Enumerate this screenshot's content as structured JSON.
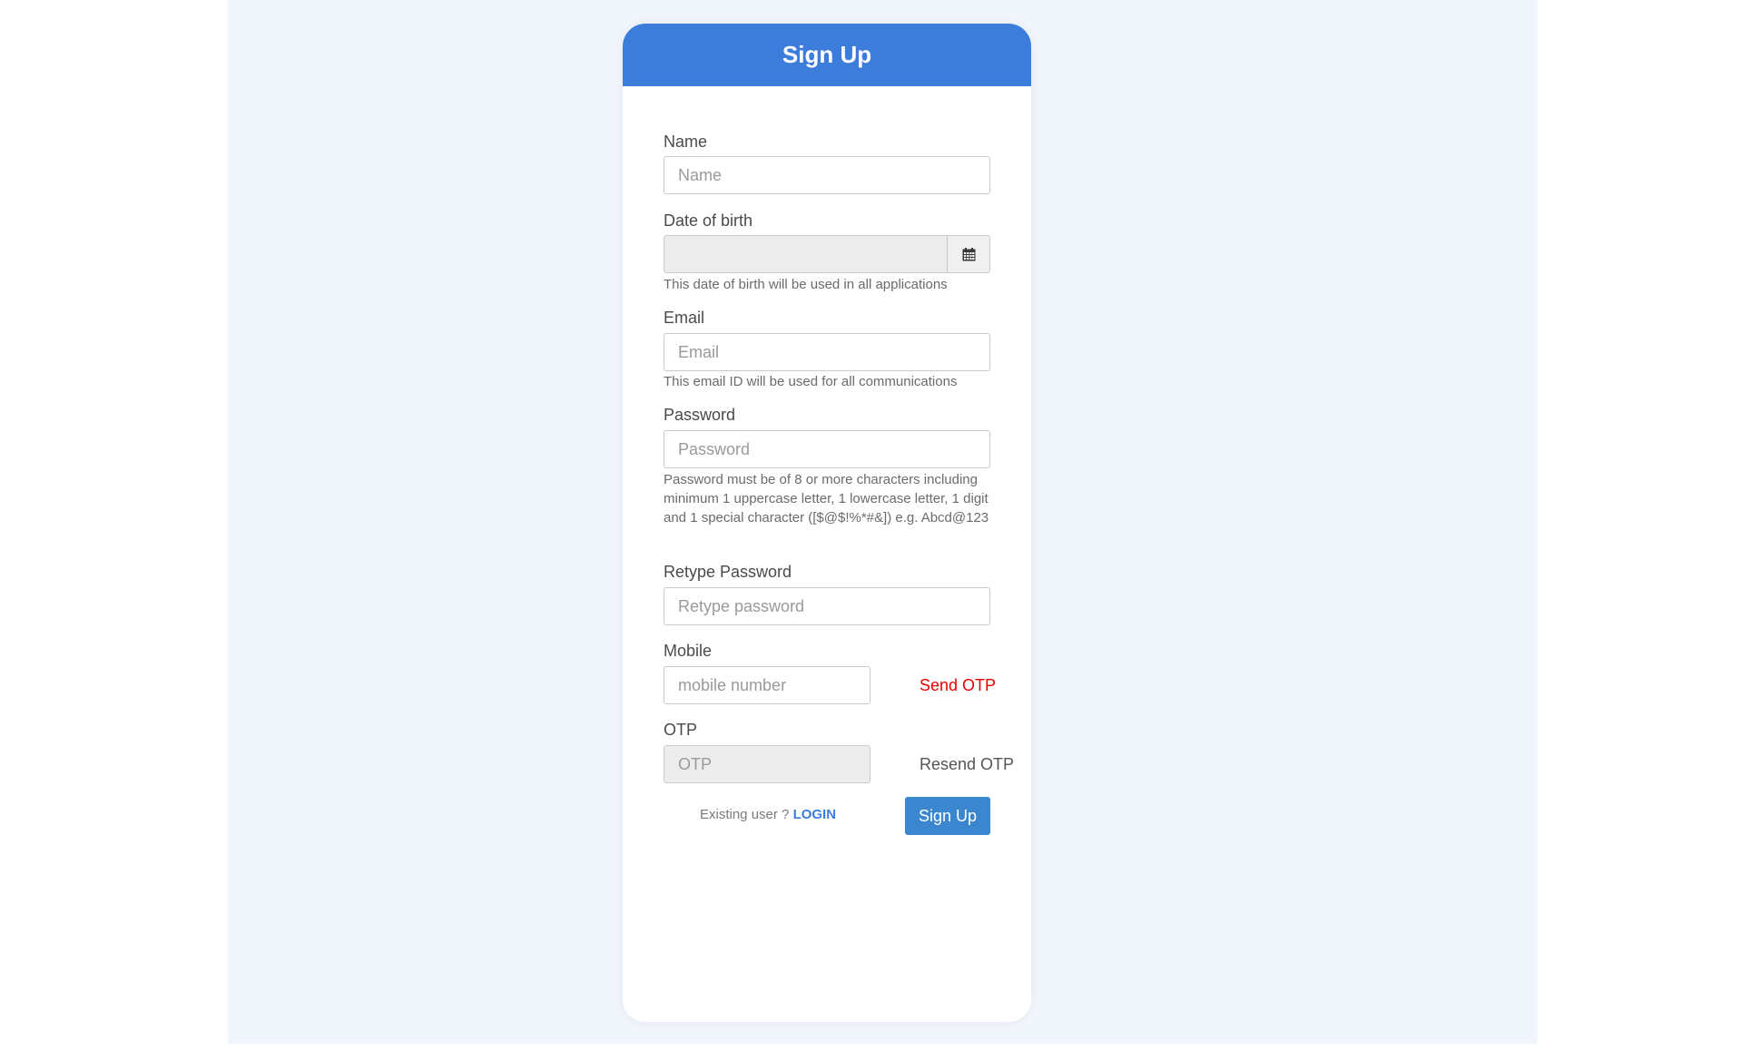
{
  "header": {
    "title": "Sign Up"
  },
  "form": {
    "name": {
      "label": "Name",
      "placeholder": "Name",
      "value": ""
    },
    "dob": {
      "label": "Date of birth",
      "value": "",
      "help": "This date of birth will be used in all applications",
      "icon": "calendar-icon"
    },
    "email": {
      "label": "Email",
      "placeholder": "Email",
      "value": "",
      "help": "This email ID will be used for all communications"
    },
    "password": {
      "label": "Password",
      "placeholder": "Password",
      "value": "",
      "help": "Password must be of 8 or more characters including minimum 1 uppercase letter, 1 lowercase letter, 1 digit and 1 special character ([$@$!%*#&]) e.g. Abcd@123"
    },
    "retype_password": {
      "label": "Retype Password",
      "placeholder": "Retype password",
      "value": ""
    },
    "mobile": {
      "label": "Mobile",
      "placeholder": "mobile number",
      "value": "",
      "send_otp": "Send OTP"
    },
    "otp": {
      "label": "OTP",
      "placeholder": "OTP",
      "value": "",
      "resend_otp": "Resend OTP"
    },
    "existing_user": "Existing user ?",
    "login_link": "LOGIN",
    "submit_label": "Sign Up"
  },
  "colors": {
    "header_bg": "#3c7ddc",
    "page_bg": "#f1f5fc",
    "send_otp": "#e60000",
    "resend_otp": "#555555",
    "login_link": "#3c7ddc",
    "button_bg": "#3a87cf"
  }
}
